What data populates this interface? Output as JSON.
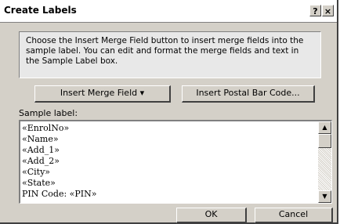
{
  "window": {
    "title": "Create Labels",
    "help_label": "?",
    "close_label": "×"
  },
  "info": {
    "text": "Choose the Insert Merge Field button to insert merge fields into the sample label.  You can edit and format the merge fields and text in the Sample Label box."
  },
  "buttons": {
    "insert_merge_field": "Insert Merge Field",
    "insert_merge_field_arrow": "▾",
    "insert_postal_bar_code": "Insert Postal Bar Code...",
    "ok": "OK",
    "cancel": "Cancel"
  },
  "sample": {
    "label": "Sample label:",
    "lines": [
      "«EnrolNo»",
      "«Name»",
      "«Add_1»",
      "«Add_2»",
      "«City»",
      "«State»",
      "PIN Code: «PIN»"
    ]
  },
  "scrollbar": {
    "up_arrow": "▲",
    "down_arrow": "▼"
  }
}
